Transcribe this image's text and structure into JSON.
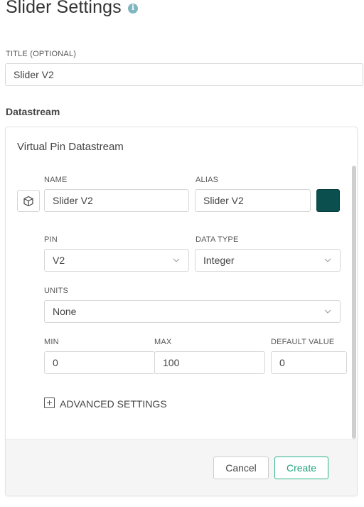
{
  "header": {
    "title": "Slider Settings",
    "info_icon": "info-icon"
  },
  "title_field": {
    "label": "TITLE (OPTIONAL)",
    "value": "Slider V2"
  },
  "datastream": {
    "section_label": "Datastream",
    "card_title": "Virtual Pin Datastream",
    "name": {
      "label": "NAME",
      "value": "Slider V2"
    },
    "alias": {
      "label": "ALIAS",
      "value": "Slider V2"
    },
    "color": "#0b4f4f",
    "pin": {
      "label": "PIN",
      "value": "V2"
    },
    "data_type": {
      "label": "DATA TYPE",
      "value": "Integer"
    },
    "units": {
      "label": "UNITS",
      "value": "None"
    },
    "min": {
      "label": "MIN",
      "value": "0"
    },
    "max": {
      "label": "MAX",
      "value": "100"
    },
    "default_value": {
      "label": "DEFAULT VALUE",
      "value": "0"
    },
    "advanced": {
      "label": "ADVANCED SETTINGS",
      "icon": "plus-square-icon"
    },
    "cube_icon": "cube-icon"
  },
  "footer": {
    "cancel_label": "Cancel",
    "create_label": "Create"
  },
  "colors": {
    "accent": "#1fa37b",
    "info": "#7fb6bf"
  }
}
